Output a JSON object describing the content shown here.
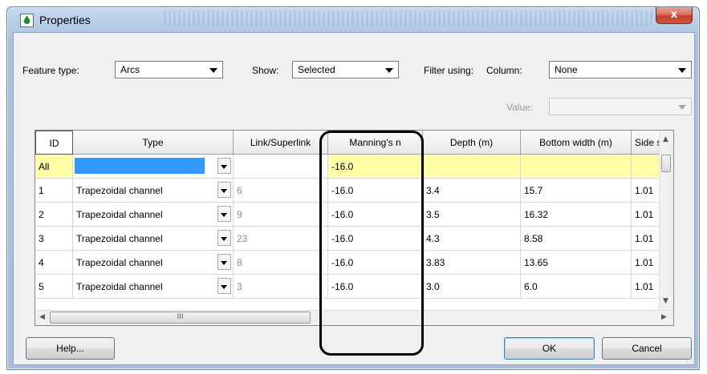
{
  "window": {
    "title": "Properties",
    "close_label": "x"
  },
  "toolbar": {
    "feature_type_label": "Feature type:",
    "feature_type_value": "Arcs",
    "show_label": "Show:",
    "show_value": "Selected",
    "filter_label": "Filter using:",
    "column_label": "Column:",
    "column_value": "None",
    "value_label": "Value:",
    "value_value": ""
  },
  "grid": {
    "headers": [
      "ID",
      "Type",
      "Link/Superlink",
      "Manning's n",
      "Depth (m)",
      "Bottom width (m)",
      "Side s"
    ],
    "all_row": {
      "id": "All",
      "type": "",
      "link": "",
      "manning": "-16.0",
      "depth": "",
      "bottom_width": "",
      "side": ""
    },
    "rows": [
      {
        "id": "1",
        "type": "Trapezoidal channel",
        "link": "6",
        "manning": "-16.0",
        "depth": "3.4",
        "bottom_width": "15.7",
        "side": "1.01"
      },
      {
        "id": "2",
        "type": "Trapezoidal channel",
        "link": "9",
        "manning": "-16.0",
        "depth": "3.5",
        "bottom_width": "16.32",
        "side": "1.01"
      },
      {
        "id": "3",
        "type": "Trapezoidal channel",
        "link": "23",
        "manning": "-16.0",
        "depth": "4.3",
        "bottom_width": "8.58",
        "side": "1.01"
      },
      {
        "id": "4",
        "type": "Trapezoidal channel",
        "link": "8",
        "manning": "-16.0",
        "depth": "3.83",
        "bottom_width": "13.65",
        "side": "1.01"
      },
      {
        "id": "5",
        "type": "Trapezoidal channel",
        "link": "3",
        "manning": "-16.0",
        "depth": "3.0",
        "bottom_width": "6.0",
        "side": "1.01"
      }
    ],
    "hscroll_thumb_label": "III"
  },
  "buttons": {
    "help": "Help...",
    "ok": "OK",
    "cancel": "Cancel"
  },
  "colors": {
    "selection_blue": "#3399ff",
    "all_row_yellow": "#ffffa8"
  },
  "icons": {
    "title_icon": "water-drop-icon"
  }
}
